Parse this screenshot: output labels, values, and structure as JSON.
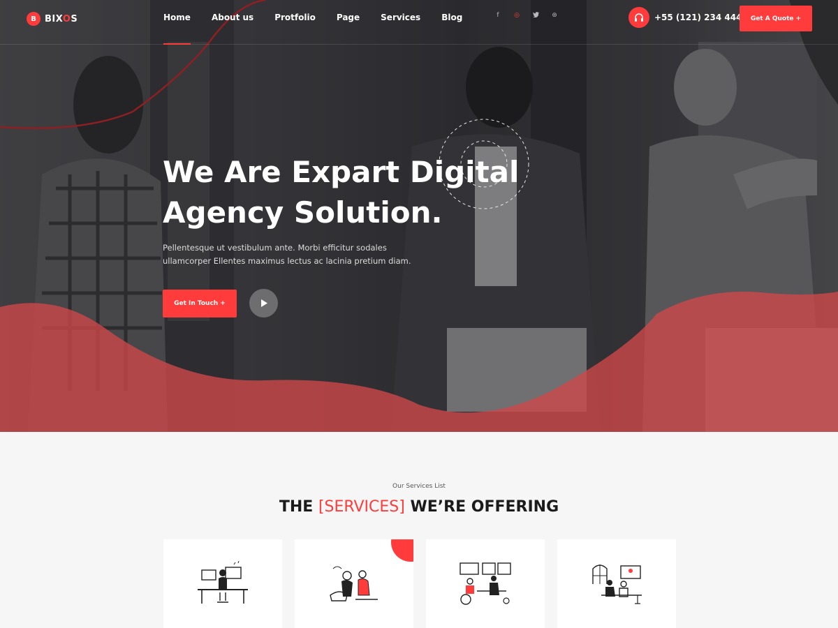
{
  "brand": {
    "mark": "B",
    "name_left": "BIX",
    "name_accent": "O",
    "name_right": "S"
  },
  "nav": {
    "items": [
      {
        "label": "Home",
        "active": true
      },
      {
        "label": "About us"
      },
      {
        "label": "Protfolio"
      },
      {
        "label": "Page"
      },
      {
        "label": "Services"
      },
      {
        "label": "Blog"
      }
    ]
  },
  "socials": [
    {
      "glyph": "f",
      "icon": "facebook-icon"
    },
    {
      "glyph": "◎",
      "icon": "pinterest-icon",
      "active": true
    },
    {
      "glyph": "🐦",
      "icon": "twitter-icon"
    },
    {
      "glyph": "⊛",
      "icon": "dribbble-icon"
    }
  ],
  "contact": {
    "phone": "+55 (121) 234 444",
    "icon": "headset-icon"
  },
  "quote_button": "Get A Quote +",
  "hero": {
    "title": "We Are Expart Digital Agency Solution.",
    "text": "Pellentesque ut vestibulum ante. Morbi efficitur sodales ullamcorper Ellentes maximus lectus ac lacinia pretium diam.",
    "cta": "Get In Touch +",
    "play_icon": "play-icon"
  },
  "services": {
    "kicker": "Our Services List",
    "title_before": "THE ",
    "title_accent": "[SERVICES]",
    "title_after": " WE’RE OFFERING",
    "cards": [
      {
        "icon": "desk-worker-illustration"
      },
      {
        "icon": "team-chat-illustration"
      },
      {
        "icon": "office-meeting-illustration"
      },
      {
        "icon": "remote-work-illustration"
      }
    ]
  },
  "colors": {
    "accent": "#ff3b3b",
    "dark": "#1b1b1b",
    "section_bg": "#f6f6f6"
  }
}
